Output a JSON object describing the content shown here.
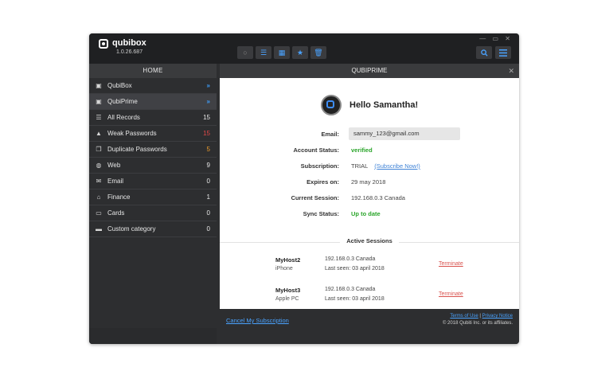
{
  "app": {
    "name": "qubibox",
    "version": "1.0.26.687"
  },
  "toolbar": [
    {
      "icon": "circle-icon",
      "glyph": "○"
    },
    {
      "icon": "list-add-icon",
      "glyph": "☰"
    },
    {
      "icon": "password-generator-icon",
      "glyph": "▦"
    },
    {
      "icon": "star-icon",
      "glyph": "★"
    },
    {
      "icon": "trash-icon",
      "glyph": "🗑"
    }
  ],
  "window_controls": "— ▭ ✕",
  "sidebar": {
    "header": "HOME",
    "items": [
      {
        "label": "QubiBox",
        "count": "»",
        "icon": "qubibox-icon"
      },
      {
        "label": "QubiPrime",
        "count": "»",
        "icon": "qubiprime-icon",
        "active": true
      },
      {
        "label": "All Records",
        "count": "15",
        "icon": "list-icon"
      },
      {
        "label": "Weak Passwords",
        "count": "15",
        "icon": "warning-icon"
      },
      {
        "label": "Duplicate Passwords",
        "count": "5",
        "icon": "duplicate-icon"
      },
      {
        "label": "Web",
        "count": "9",
        "icon": "globe-icon"
      },
      {
        "label": "Email",
        "count": "0",
        "icon": "envelope-icon"
      },
      {
        "label": "Finance",
        "count": "1",
        "icon": "bank-icon"
      },
      {
        "label": "Cards",
        "count": "0",
        "icon": "card-icon"
      },
      {
        "label": "Custom category",
        "count": "0",
        "icon": "folder-icon"
      }
    ]
  },
  "panel": {
    "title": "QUBIPRIME",
    "greeting": "Hello Samantha!",
    "fields": {
      "email_label": "Email:",
      "email_value": "sammy_123@gmail.com",
      "account_status_label": "Account Status:",
      "account_status_value": "verified",
      "subscription_label": "Subscription:",
      "subscription_value": "TRIAL",
      "subscribe_link": "(Subscribe Now!)",
      "expires_label": "Expires on:",
      "expires_value": "29 may 2018",
      "session_label": "Current Session:",
      "session_value": "192.168.0.3 Canada",
      "sync_label": "Sync Status:",
      "sync_value": "Up to date"
    },
    "sessions_title": "Active Sessions",
    "sessions": [
      {
        "host": "MyHost2",
        "device": "iPhone",
        "location": "192.168.0.3 Canada",
        "last_seen": "Last seen: 03 april 2018",
        "action": "Terminate"
      },
      {
        "host": "MyHost3",
        "device": "Apple PC",
        "location": "192.168.0.3 Canada",
        "last_seen": "Last seen: 03 april 2018",
        "action": "Terminate"
      }
    ]
  },
  "footer": {
    "cancel_link": "Cancel My Subscription",
    "terms": "Terms of Use",
    "separator": " | ",
    "privacy": "Privacy Notice",
    "copyright": "© 2018 Qubiti Inc. or its affiliates."
  }
}
